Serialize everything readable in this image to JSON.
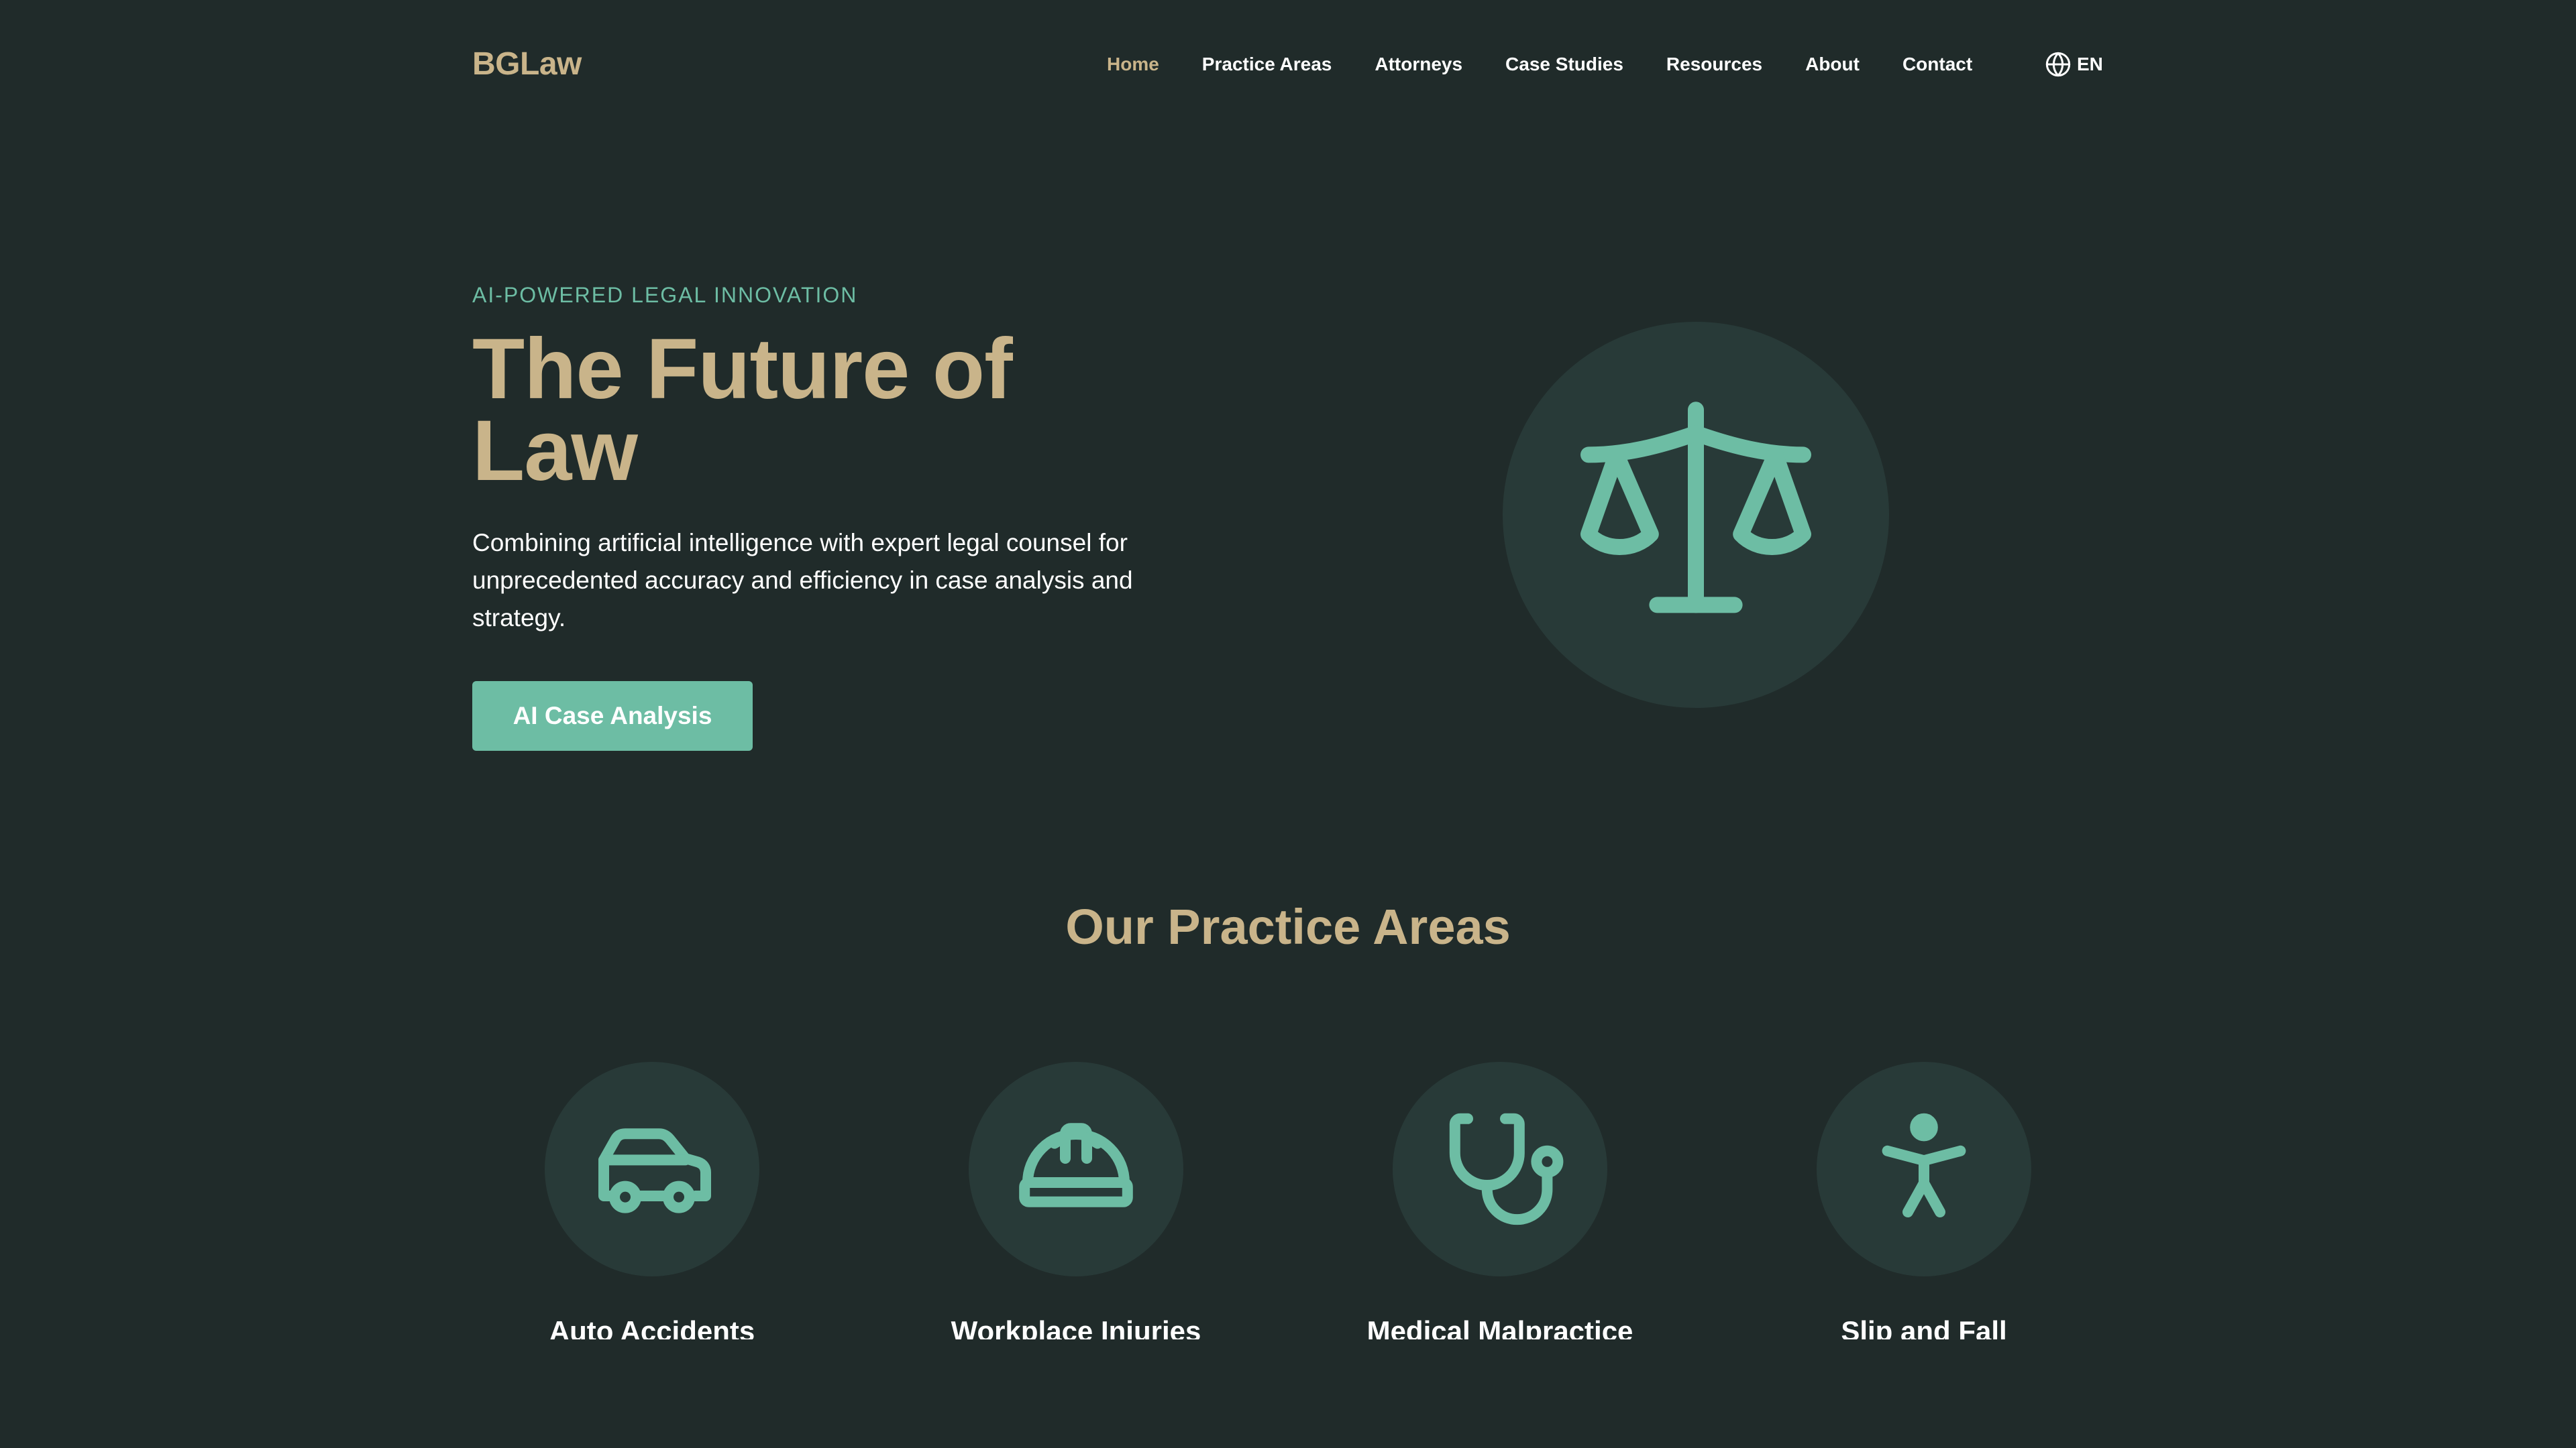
{
  "header": {
    "logo": "BGLaw",
    "nav": [
      {
        "label": "Home",
        "active": true
      },
      {
        "label": "Practice Areas"
      },
      {
        "label": "Attorneys"
      },
      {
        "label": "Case Studies"
      },
      {
        "label": "Resources"
      },
      {
        "label": "About"
      },
      {
        "label": "Contact"
      }
    ],
    "language": {
      "label": "EN",
      "icon": "globe-icon"
    }
  },
  "hero": {
    "eyebrow": "AI-POWERED LEGAL INNOVATION",
    "title": "The Future of Law",
    "description": "Combining artificial intelligence with expert legal counsel for unprecedented accuracy and efficiency in case analysis and strategy.",
    "cta_label": "AI Case Analysis",
    "illustration_icon": "scales-of-justice-icon"
  },
  "practice_areas": {
    "title": "Our Practice Areas",
    "items": [
      {
        "label": "Auto Accidents",
        "icon": "car-icon"
      },
      {
        "label": "Workplace Injuries",
        "icon": "hard-hat-icon"
      },
      {
        "label": "Medical Malpractice",
        "icon": "stethoscope-icon"
      },
      {
        "label": "Slip and Fall",
        "icon": "person-icon"
      }
    ]
  },
  "colors": {
    "background": "#202b2a",
    "accent_gold": "#c9b48a",
    "accent_teal": "#6dbda4",
    "circle_bg": "#283a38",
    "text": "#ffffff"
  }
}
